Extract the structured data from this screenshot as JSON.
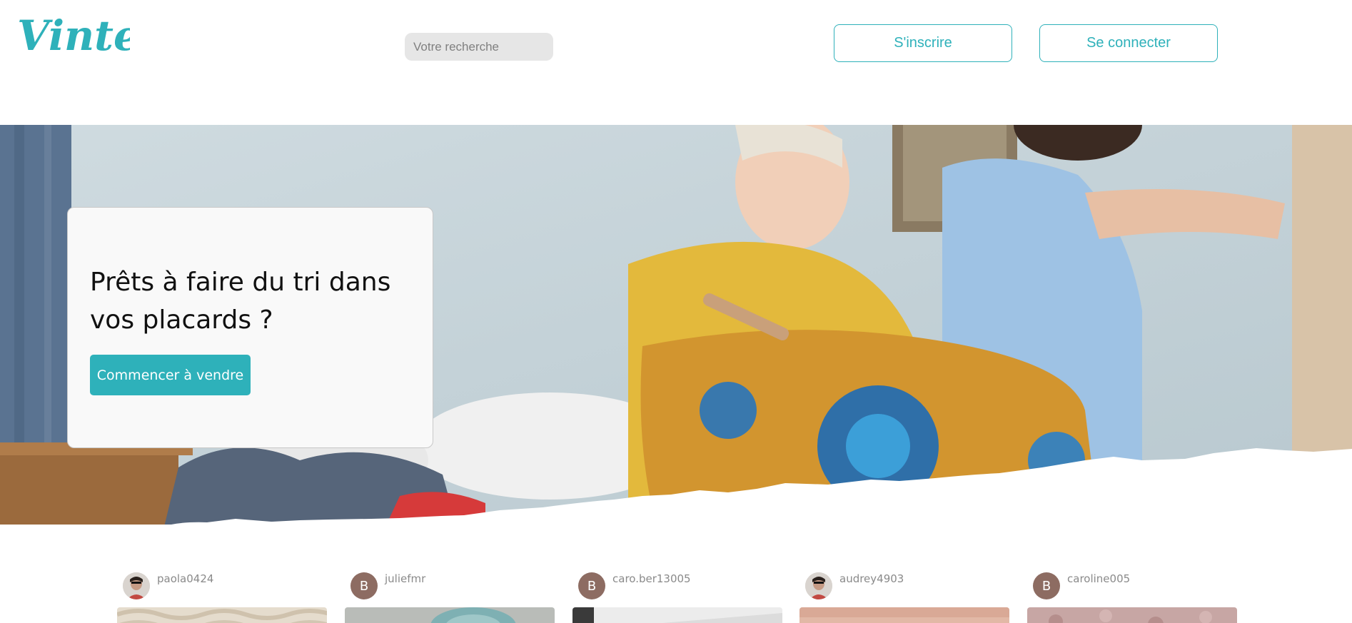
{
  "header": {
    "logo_text": "Vinted",
    "search_placeholder": "Votre recherche",
    "signup_label": "S'inscrire",
    "login_label": "Se connecter"
  },
  "hero": {
    "title": "Prêts à faire du tri dans vos placards ?",
    "cta_label": "Commencer à vendre"
  },
  "feed": {
    "items": [
      {
        "username": "paola0424",
        "avatar_type": "photo"
      },
      {
        "username": "juliefmr",
        "avatar_type": "letter",
        "avatar_letter": "B"
      },
      {
        "username": "caro.ber13005",
        "avatar_type": "letter",
        "avatar_letter": "B"
      },
      {
        "username": "audrey4903",
        "avatar_type": "photo"
      },
      {
        "username": "caroline005",
        "avatar_type": "letter",
        "avatar_letter": "B"
      }
    ]
  },
  "colors": {
    "brand": "#2eb1ba",
    "avatar_letter_bg": "#8d6c62",
    "search_bg": "#e6e6e6"
  }
}
